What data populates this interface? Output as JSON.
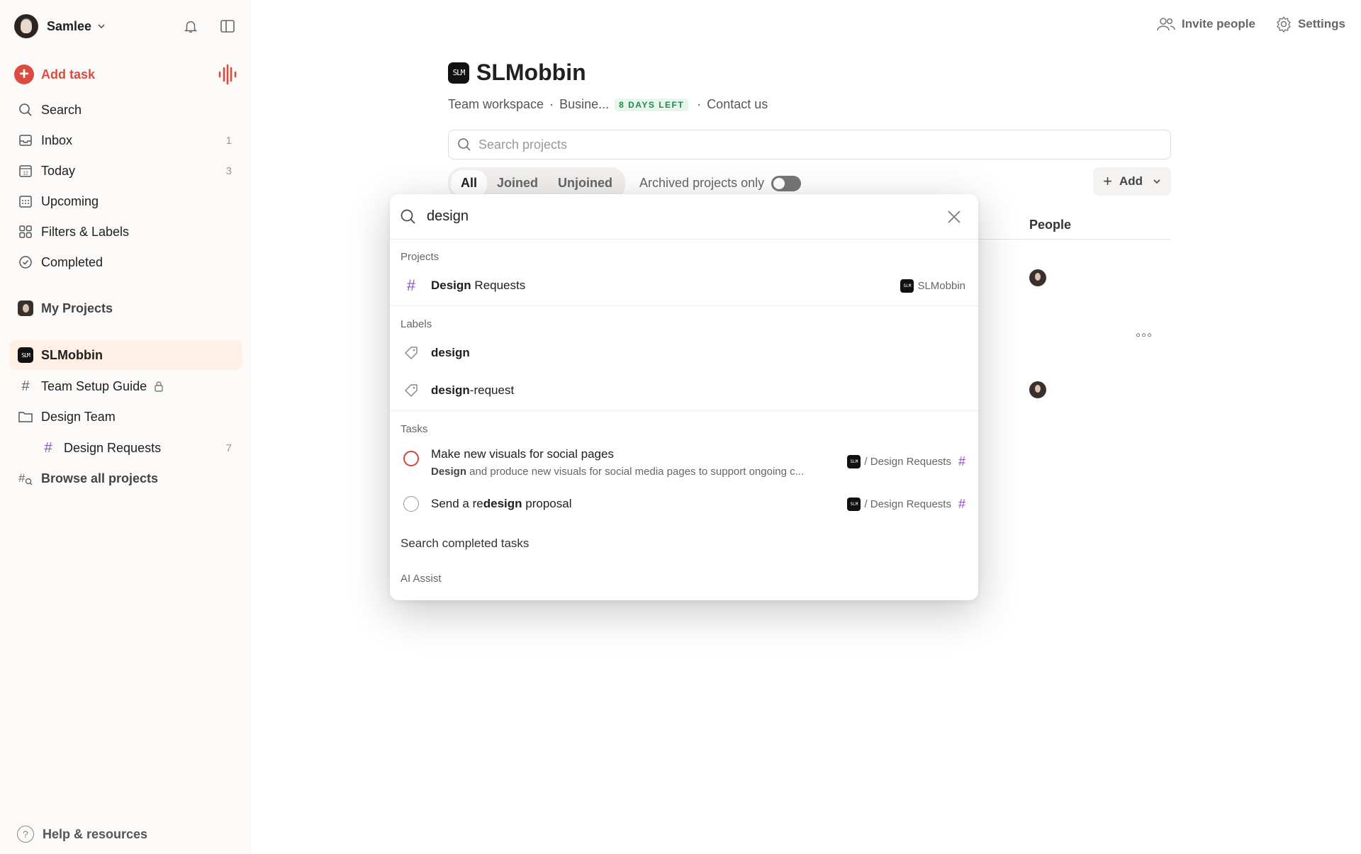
{
  "user": {
    "name": "Samlee"
  },
  "sidebar": {
    "add_task": "Add task",
    "nav": [
      {
        "label": "Search",
        "count": ""
      },
      {
        "label": "Inbox",
        "count": "1"
      },
      {
        "label": "Today",
        "count": "3"
      },
      {
        "label": "Upcoming",
        "count": ""
      },
      {
        "label": "Filters & Labels",
        "count": ""
      },
      {
        "label": "Completed",
        "count": ""
      }
    ],
    "today_day": "12",
    "my_projects": "My Projects",
    "workspace": "SLMobbin",
    "items": [
      {
        "label": "Team Setup Guide",
        "count": ""
      },
      {
        "label": "Design Team",
        "count": ""
      },
      {
        "label": "Design Requests",
        "count": "7"
      },
      {
        "label": "Browse all projects",
        "count": ""
      }
    ],
    "help": "Help & resources"
  },
  "topbar": {
    "invite": "Invite people",
    "settings": "Settings"
  },
  "main": {
    "logo_text": "SLM",
    "title": "SLMobbin",
    "subtitle": {
      "workspace_type": "Team workspace",
      "plan": "Busine...",
      "badge": "8 DAYS LEFT",
      "contact": "Contact us"
    },
    "search_placeholder": "Search projects",
    "filters": [
      "All",
      "Joined",
      "Unjoined"
    ],
    "selected_filter": "All",
    "archived_label": "Archived projects only",
    "archived_on": false,
    "add_label": "Add",
    "people_header": "People"
  },
  "search_modal": {
    "query": "design",
    "sections": {
      "projects": "Projects",
      "labels": "Labels",
      "tasks": "Tasks",
      "ai": "AI Assist"
    },
    "project_result": {
      "match": "Design",
      "rest": " Requests",
      "workspace": "SLMobbin"
    },
    "label_results": [
      {
        "match": "design",
        "rest": ""
      },
      {
        "match": "design",
        "rest": "-request"
      }
    ],
    "task_results": [
      {
        "title": "Make new visuals for social pages",
        "desc_match": "Design",
        "desc_rest": " and produce new visuals for social media pages to support ongoing c...",
        "project": "/ Design Requests"
      },
      {
        "title_pre": "Send a re",
        "title_match": "design",
        "title_post": " proposal",
        "project": "/ Design Requests"
      }
    ],
    "search_completed": "Search completed tasks"
  },
  "colors": {
    "accent": "#dc4c3e",
    "active_bg": "#ffefe5",
    "badge_green": "#1f8b4d",
    "project_hash": "#8e51c9"
  }
}
